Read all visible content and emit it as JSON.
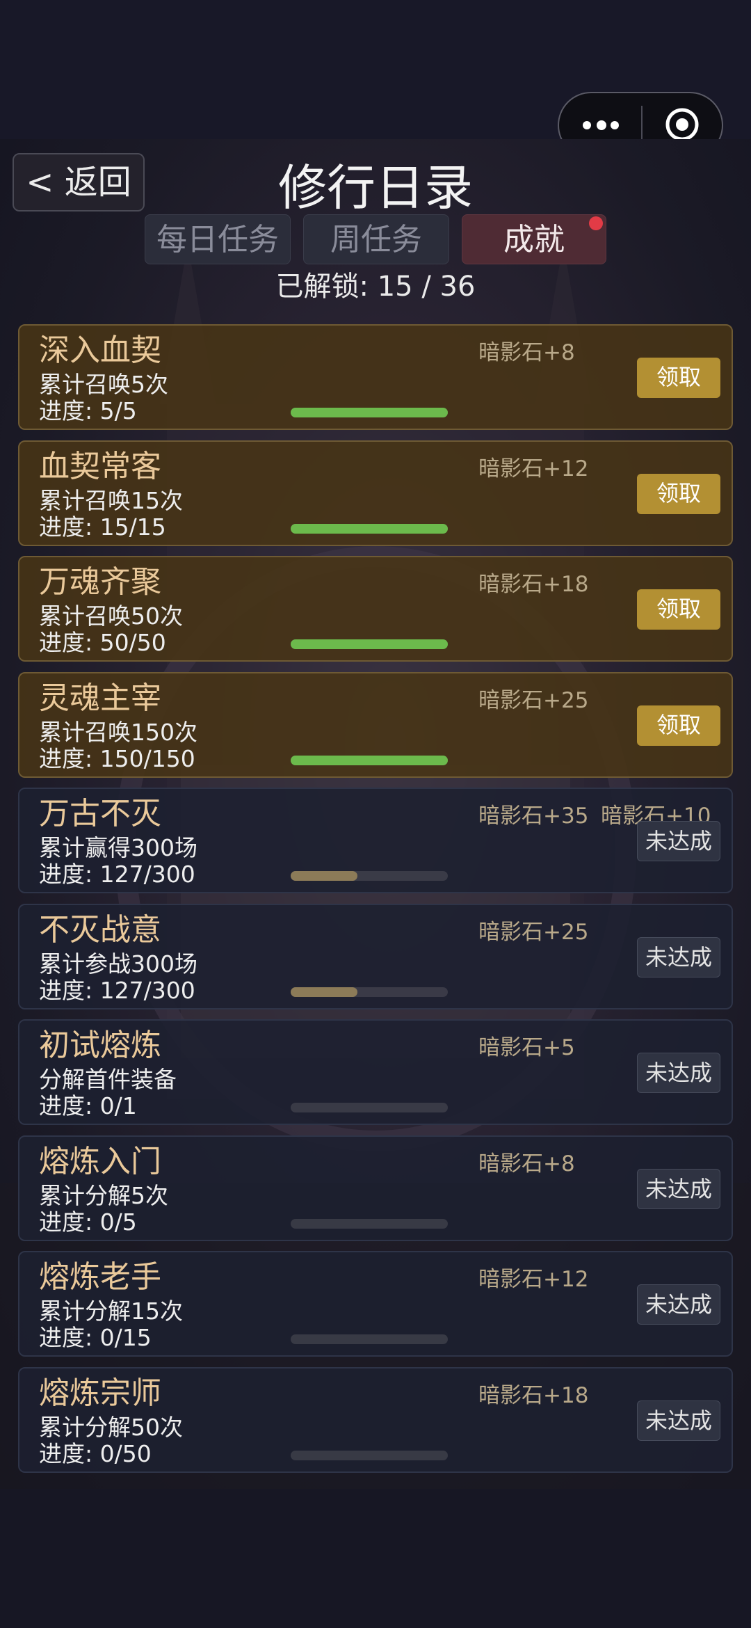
{
  "header": {
    "back_label": "< 返回",
    "title": "修行日录"
  },
  "tabs": [
    {
      "label": "每日任务",
      "active": false
    },
    {
      "label": "周任务",
      "active": false
    },
    {
      "label": "成就",
      "active": true,
      "has_badge": true
    }
  ],
  "unlocked_text": "已解锁: 15 / 36",
  "achievements": [
    {
      "name": "深入血契",
      "desc": "累计召唤5次",
      "progress_text": "进度: 5/5",
      "reward": "暗影石+8",
      "reward2": "",
      "button": "领取",
      "done": true,
      "progress": 1.0
    },
    {
      "name": "血契常客",
      "desc": "累计召唤15次",
      "progress_text": "进度: 15/15",
      "reward": "暗影石+12",
      "reward2": "",
      "button": "领取",
      "done": true,
      "progress": 1.0
    },
    {
      "name": "万魂齐聚",
      "desc": "累计召唤50次",
      "progress_text": "进度: 50/50",
      "reward": "暗影石+18",
      "reward2": "",
      "button": "领取",
      "done": true,
      "progress": 1.0
    },
    {
      "name": "灵魂主宰",
      "desc": "累计召唤150次",
      "progress_text": "进度: 150/150",
      "reward": "暗影石+25",
      "reward2": "",
      "button": "领取",
      "done": true,
      "progress": 1.0
    },
    {
      "name": "万古不灭",
      "desc": "累计赢得300场",
      "progress_text": "进度: 127/300",
      "reward": "暗影石+35",
      "reward2": "暗影石+10",
      "button": "未达成",
      "done": false,
      "progress": 0.423
    },
    {
      "name": "不灭战意",
      "desc": "累计参战300场",
      "progress_text": "进度: 127/300",
      "reward": "暗影石+25",
      "reward2": "",
      "button": "未达成",
      "done": false,
      "progress": 0.423
    },
    {
      "name": "初试熔炼",
      "desc": "分解首件装备",
      "progress_text": "进度: 0/1",
      "reward": "暗影石+5",
      "reward2": "",
      "button": "未达成",
      "done": false,
      "progress": 0
    },
    {
      "name": "熔炼入门",
      "desc": "累计分解5次",
      "progress_text": "进度: 0/5",
      "reward": "暗影石+8",
      "reward2": "",
      "button": "未达成",
      "done": false,
      "progress": 0
    },
    {
      "name": "熔炼老手",
      "desc": "累计分解15次",
      "progress_text": "进度: 0/15",
      "reward": "暗影石+12",
      "reward2": "",
      "button": "未达成",
      "done": false,
      "progress": 0
    },
    {
      "name": "熔炼宗师",
      "desc": "累计分解50次",
      "progress_text": "进度: 0/50",
      "reward": "暗影石+18",
      "reward2": "",
      "button": "未达成",
      "done": false,
      "progress": 0
    }
  ]
}
